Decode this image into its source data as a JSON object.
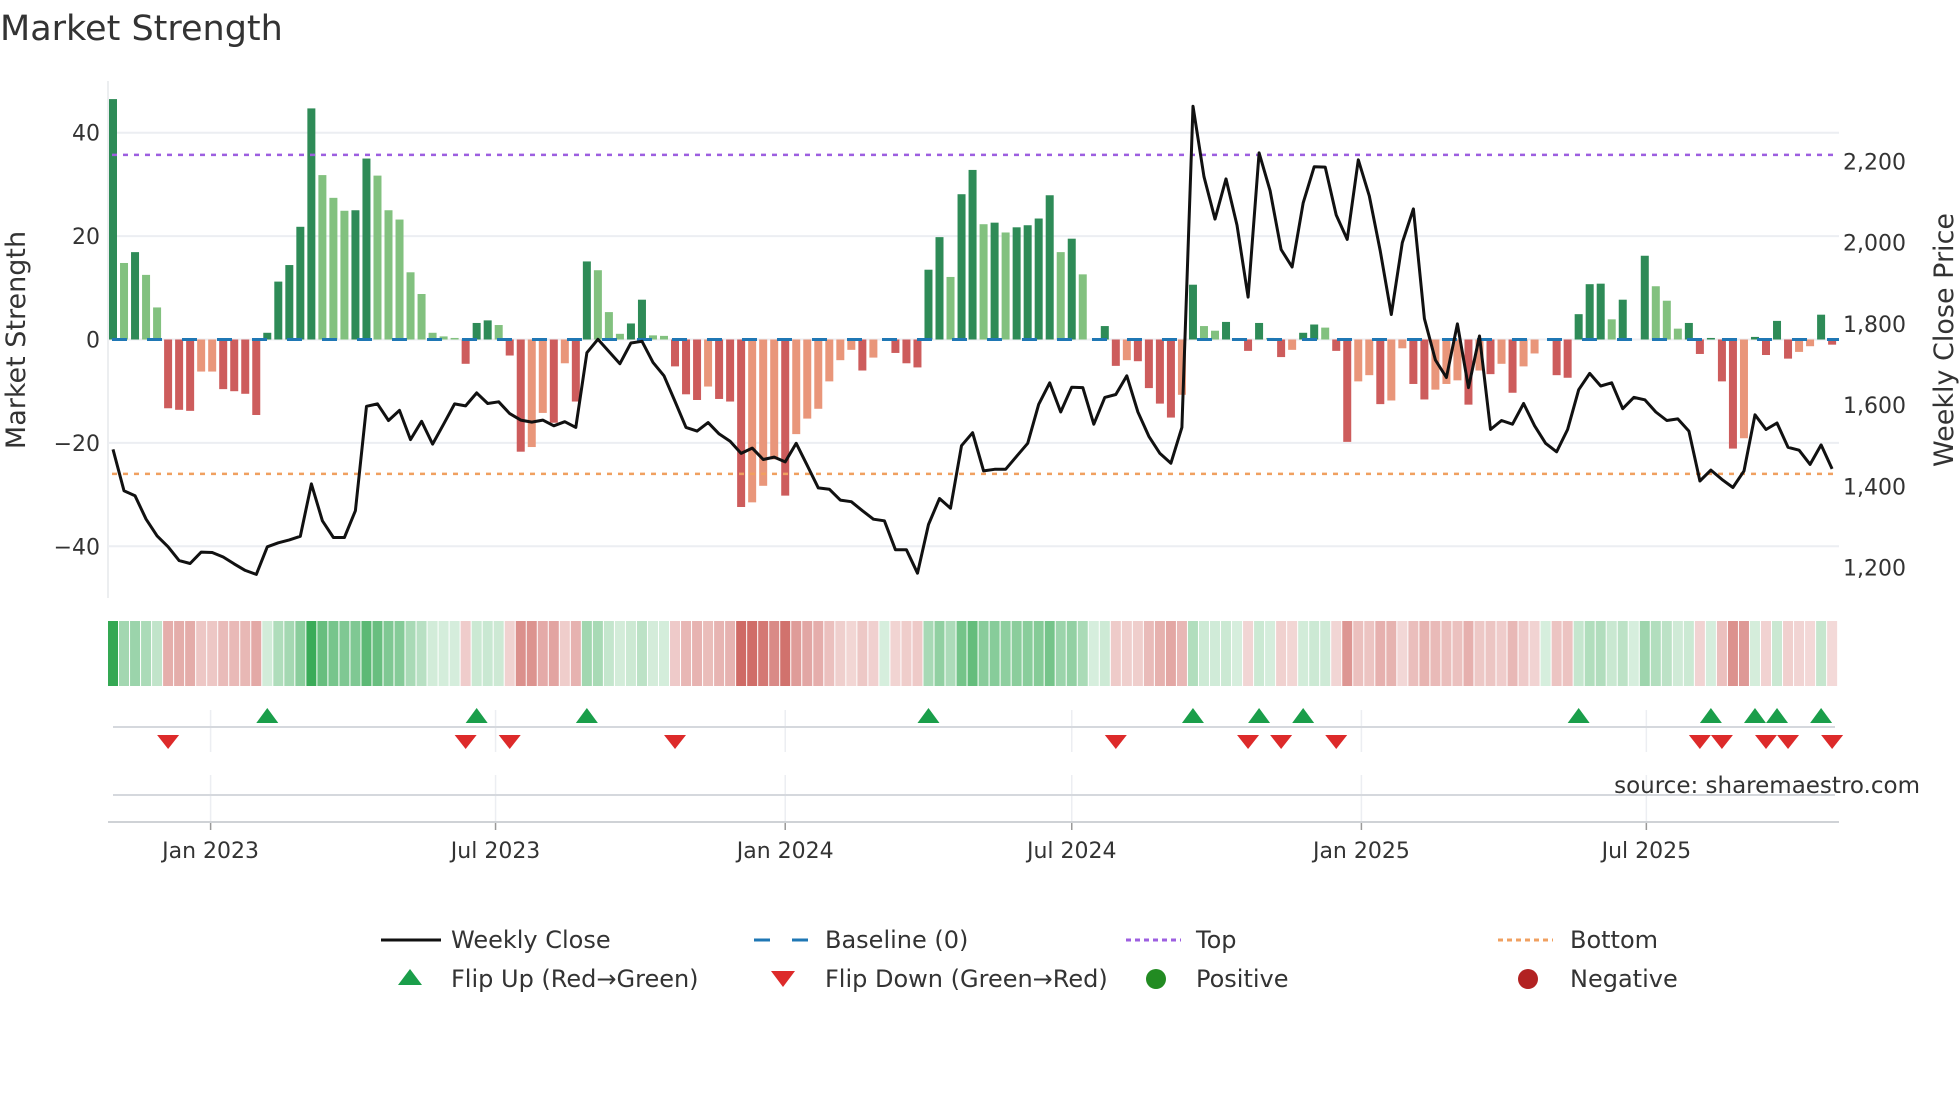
{
  "title": "Market Strength",
  "source": "source: sharemaestro.com",
  "colors": {
    "pos_strong": "#2e8b57",
    "pos_weak": "#82c17f",
    "neg_strong": "#cd5c5c",
    "neg_weak": "#e9967a",
    "line": "#111111",
    "baseline": "#1f77b4",
    "top": "#9d5fe0",
    "bottom": "#f0a060",
    "flip_up": "#1a9e4a",
    "flip_down": "#dd2a2a",
    "positive": "#228b22",
    "negative": "#b22222"
  },
  "legend": [
    {
      "key": "weekly_close",
      "label": "Weekly Close",
      "icon": "solid-line"
    },
    {
      "key": "baseline",
      "label": "Baseline (0)",
      "icon": "dashed-line"
    },
    {
      "key": "top",
      "label": "Top",
      "icon": "dotted-line"
    },
    {
      "key": "bottom",
      "label": "Bottom",
      "icon": "dotted-line"
    },
    {
      "key": "flip_up",
      "label": "Flip Up (Red→Green)",
      "icon": "triangle-up"
    },
    {
      "key": "flip_down",
      "label": "Flip Down (Green→Red)",
      "icon": "triangle-down"
    },
    {
      "key": "positive",
      "label": "Positive",
      "icon": "circle"
    },
    {
      "key": "negative",
      "label": "Negative",
      "icon": "circle"
    }
  ],
  "chart_data": {
    "type": "bar",
    "title": "Market Strength",
    "ylabel": "Market Strength",
    "y2label": "Weekly Close Price",
    "ylim": [
      -50,
      50
    ],
    "y2lim": [
      1125,
      2398
    ],
    "yticks": [
      40,
      20,
      0,
      -20,
      -40
    ],
    "yticklabels": [
      "40",
      "20",
      "0",
      "−20",
      "−40"
    ],
    "y2ticks": [
      2200,
      2000,
      1800,
      1600,
      1400,
      1200
    ],
    "y2ticklabels": [
      "2,200",
      "2,000",
      "1,800",
      "1,600",
      "1,400",
      "1,200"
    ],
    "xticks": [
      {
        "date": "2023-01-01",
        "label": "Jan 2023"
      },
      {
        "date": "2023-07-01",
        "label": "Jul 2023"
      },
      {
        "date": "2024-01-01",
        "label": "Jan 2024"
      },
      {
        "date": "2024-07-01",
        "label": "Jul 2024"
      },
      {
        "date": "2025-01-01",
        "label": "Jan 2025"
      },
      {
        "date": "2025-07-01",
        "label": "Jul 2025"
      }
    ],
    "first_week": "2022-10-31",
    "frequency": "weekly",
    "top_level": 35.7,
    "bottom_level": -26,
    "grid": true,
    "legend_position": "bottom",
    "strength": [
      46.5,
      14.8,
      16.9,
      12.5,
      6.2,
      -13.3,
      -13.6,
      -13.8,
      -6.2,
      -6.2,
      -9.6,
      -10,
      -10.5,
      -14.6,
      1.3,
      11.2,
      14.4,
      21.8,
      44.7,
      31.8,
      27.4,
      24.9,
      25,
      35,
      31.7,
      25,
      23.2,
      13,
      8.8,
      1.3,
      0.6,
      0.3,
      -4.7,
      3.2,
      3.7,
      2.8,
      -3.1,
      -21.7,
      -20.8,
      -14.2,
      -16.1,
      -4.6,
      -12,
      15.1,
      13.4,
      5.3,
      1.1,
      3.1,
      7.7,
      0.8,
      0.7,
      -5.2,
      -10.6,
      -11.7,
      -9.1,
      -11.5,
      -12,
      -32.4,
      -31.5,
      -28.3,
      -23.2,
      -30.2,
      -18.3,
      -15.3,
      -13.4,
      -8.1,
      -4,
      -2,
      -6,
      -3.5,
      0,
      -2.6,
      -4.6,
      -5.4,
      13.5,
      19.8,
      12.1,
      28.1,
      32.8,
      22.3,
      22.6,
      20.7,
      21.7,
      22.1,
      23.4,
      27.9,
      16.9,
      19.5,
      12.6,
      0,
      2.6,
      -5.1,
      -4,
      -4.2,
      -9.4,
      -12.4,
      -15.1,
      -10.7,
      10.6,
      2.6,
      1.7,
      3.4,
      0,
      -2.2,
      3.2,
      0.3,
      -3.4,
      -2,
      1.3,
      2.9,
      2.3,
      -2.2,
      -19.8,
      -8.1,
      -6.9,
      -12.5,
      -11.8,
      -1.7,
      -8.6,
      -11.6,
      -9.7,
      -8.6,
      -7.9,
      -12.6,
      -6,
      -6.7,
      -4.7,
      -10.3,
      -5.2,
      -2.7,
      0,
      -6.9,
      -7.4,
      4.9,
      10.7,
      10.8,
      3.9,
      7.7,
      0,
      16.2,
      10.3,
      7.5,
      2.1,
      3.2,
      -2.8,
      0.3,
      -8.1,
      -21.1,
      -19.1,
      0.5,
      -3,
      3.6,
      -3.7,
      -2.4,
      -1.3,
      4.8,
      -1
    ],
    "weekly_close": [
      1491,
      1389,
      1377,
      1319,
      1278,
      1251,
      1217,
      1210,
      1238,
      1237,
      1226,
      1209,
      1193,
      1183,
      1251,
      1261,
      1268,
      1277,
      1406,
      1315,
      1274,
      1274,
      1340,
      1597,
      1603,
      1562,
      1587,
      1515,
      1560,
      1504,
      1553,
      1603,
      1598,
      1630,
      1604,
      1608,
      1579,
      1563,
      1558,
      1563,
      1549,
      1559,
      1545,
      1729,
      1762,
      1732,
      1702,
      1753,
      1757,
      1705,
      1672,
      1609,
      1545,
      1536,
      1557,
      1529,
      1511,
      1481,
      1494,
      1466,
      1472,
      1460,
      1506,
      1451,
      1396,
      1393,
      1366,
      1362,
      1340,
      1319,
      1315,
      1244,
      1244,
      1186,
      1306,
      1370,
      1346,
      1500,
      1532,
      1438,
      1442,
      1442,
      1474,
      1506,
      1602,
      1655,
      1583,
      1644,
      1643,
      1553,
      1619,
      1626,
      1672,
      1583,
      1523,
      1481,
      1457,
      1545,
      2336,
      2162,
      2058,
      2157,
      2043,
      1866,
      2221,
      2128,
      1983,
      1940,
      2098,
      2187,
      2186,
      2068,
      2008,
      2204,
      2115,
      1979,
      1823,
      2000,
      2083,
      1813,
      1711,
      1668,
      1800,
      1643,
      1770,
      1540,
      1562,
      1553,
      1604,
      1549,
      1506,
      1485,
      1540,
      1638,
      1678,
      1647,
      1655,
      1591,
      1619,
      1613,
      1583,
      1562,
      1566,
      1536,
      1413,
      1440,
      1417,
      1397,
      1438,
      1576,
      1540,
      1556,
      1496,
      1489,
      1454,
      1502,
      1443
    ],
    "flip_up_weeks": [
      14,
      33,
      43,
      74,
      98,
      104,
      108,
      133,
      145,
      149,
      151,
      155
    ],
    "flip_down_weeks": [
      5,
      32,
      36,
      51,
      91,
      103,
      106,
      111,
      144,
      146,
      150,
      152,
      156
    ]
  }
}
